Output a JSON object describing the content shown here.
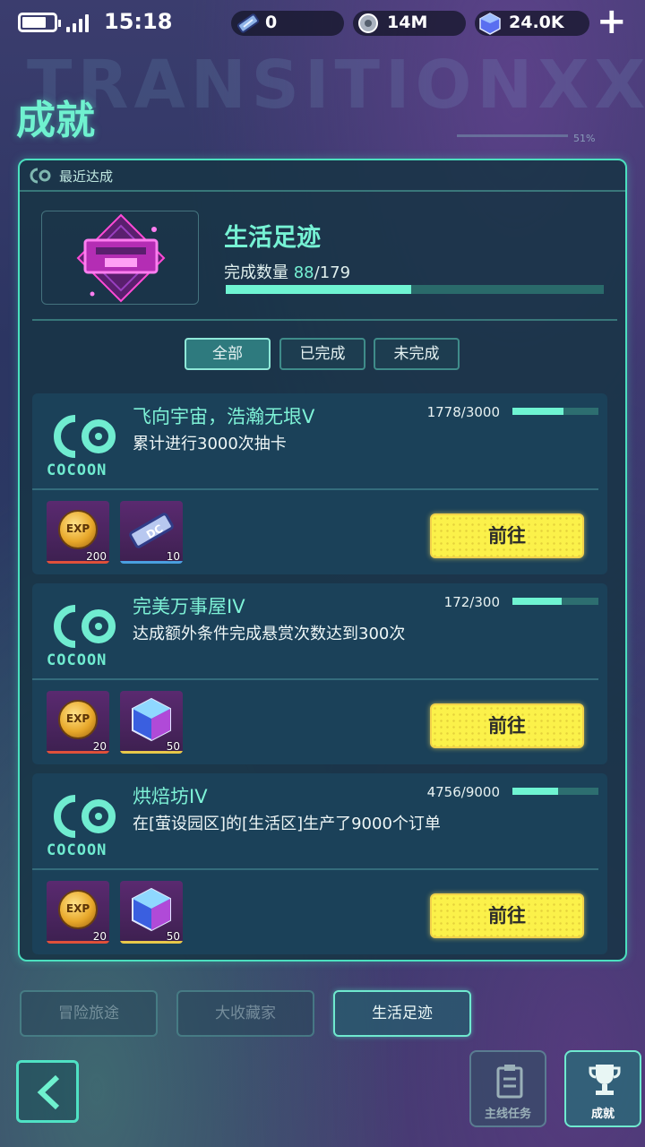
{
  "status": {
    "time": "15:18"
  },
  "currency": [
    {
      "icon": "ticket-icon",
      "value": "0"
    },
    {
      "icon": "gear-coin-icon",
      "value": "14M"
    },
    {
      "icon": "cube-gem-icon",
      "value": "24.0K"
    }
  ],
  "header": {
    "title": "成就",
    "bg_text": "TRANSITIONXXX",
    "pct": "51%"
  },
  "recent": {
    "label": "最近达成"
  },
  "summary": {
    "title": "生活足迹",
    "count_label": "完成数量",
    "done": "88",
    "total": "/179",
    "progress": 0.49
  },
  "filters": [
    {
      "label": "全部",
      "active": true
    },
    {
      "label": "已完成",
      "active": false
    },
    {
      "label": "未完成",
      "active": false
    }
  ],
  "achievements": [
    {
      "name": "飞向宇宙，浩瀚无垠V",
      "desc": "累计进行3000次抽卡",
      "progress_text": "1778/3000",
      "progress": 0.593,
      "logo": "COCOON",
      "rewards": [
        {
          "icon": "exp-coin-icon",
          "label": "EXP",
          "count": "200"
        },
        {
          "icon": "ticket-icon",
          "label": "DC",
          "count": "10"
        }
      ],
      "action": "前往"
    },
    {
      "name": "完美万事屋IV",
      "desc": "达成额外条件完成悬赏次数达到300次",
      "progress_text": "172/300",
      "progress": 0.573,
      "logo": "COCOON",
      "rewards": [
        {
          "icon": "exp-coin-icon",
          "label": "EXP",
          "count": "20"
        },
        {
          "icon": "cube-gem-icon",
          "label": "",
          "count": "50"
        }
      ],
      "action": "前往"
    },
    {
      "name": "烘焙坊IV",
      "desc": "在[萤设园区]的[生活区]生产了9000个订单",
      "progress_text": "4756/9000",
      "progress": 0.528,
      "logo": "COCOON",
      "rewards": [
        {
          "icon": "exp-coin-icon",
          "label": "EXP",
          "count": "20"
        },
        {
          "icon": "cube-gem-icon",
          "label": "",
          "count": "50"
        }
      ],
      "action": "前往"
    }
  ],
  "bottom_tabs": [
    {
      "label": "冒险旅途",
      "active": false
    },
    {
      "label": "大收藏家",
      "active": false
    },
    {
      "label": "生活足迹",
      "active": true
    }
  ],
  "nav": {
    "main_quest": "主线任务",
    "achievements": "成就"
  },
  "colors": {
    "accent": "#6ff1cf",
    "button": "#fbf14a"
  }
}
